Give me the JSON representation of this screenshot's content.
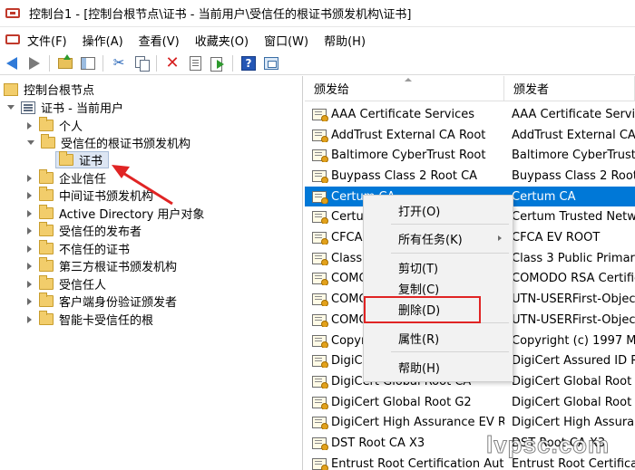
{
  "window": {
    "title": "控制台1 - [控制台根节点\\证书 - 当前用户\\受信任的根证书颁发机构\\证书]"
  },
  "menubar": {
    "items": [
      "文件(F)",
      "操作(A)",
      "查看(V)",
      "收藏夹(O)",
      "窗口(W)",
      "帮助(H)"
    ]
  },
  "toolbar": {
    "icons": [
      "back-icon",
      "forward-icon",
      "up-folder-icon",
      "show-hide-tree-icon",
      "cut-icon",
      "copy-icon",
      "delete-icon",
      "properties-icon",
      "export-icon",
      "help-icon",
      "action-pane-icon"
    ]
  },
  "tree": {
    "root": "控制台根节点",
    "store": "证书 - 当前用户",
    "nodes": [
      {
        "label": "个人",
        "expanded": false
      },
      {
        "label": "受信任的根证书颁发机构",
        "expanded": true
      },
      {
        "label": "证书",
        "selected": true
      },
      {
        "label": "企业信任",
        "expanded": false
      },
      {
        "label": "中间证书颁发机构",
        "expanded": false
      },
      {
        "label": "Active Directory 用户对象",
        "expanded": false
      },
      {
        "label": "受信任的发布者",
        "expanded": false
      },
      {
        "label": "不信任的证书",
        "expanded": false
      },
      {
        "label": "第三方根证书颁发机构",
        "expanded": false
      },
      {
        "label": "受信任人",
        "expanded": false
      },
      {
        "label": "客户端身份验证颁发者",
        "expanded": false
      },
      {
        "label": "智能卡受信任的根",
        "expanded": false
      }
    ]
  },
  "list": {
    "columns": [
      "颁发给",
      "颁发者"
    ],
    "rows": [
      {
        "issued_to": "AAA Certificate Services",
        "issued_by": "AAA Certificate Service"
      },
      {
        "issued_to": "AddTrust External CA Root",
        "issued_by": "AddTrust External CA Ro"
      },
      {
        "issued_to": "Baltimore CyberTrust Root",
        "issued_by": "Baltimore CyberTrust Ro"
      },
      {
        "issued_to": "Buypass Class 2 Root CA",
        "issued_by": "Buypass Class 2 Root CA"
      },
      {
        "issued_to": "Certum CA",
        "issued_by": "Certum CA",
        "selected": true
      },
      {
        "issued_to": "Certum",
        "issued_by": "Certum Trusted Netwo"
      },
      {
        "issued_to": "CFCA",
        "issued_by": "CFCA EV ROOT"
      },
      {
        "issued_to": "Class 3",
        "issued_by": "Class 3 Public Primary C"
      },
      {
        "issued_to": "COMOD",
        "issued_by": "COMODO RSA Certific"
      },
      {
        "issued_to": "COMOD",
        "issued_by": "UTN-USERFirst-Object"
      },
      {
        "issued_to": "COMOD",
        "issued_by": "UTN-USERFirst-Object"
      },
      {
        "issued_to": "Copyrig",
        "issued_by": "Copyright (c) 1997 Micr"
      },
      {
        "issued_to": "DigiCer",
        "issued_by": "DigiCert Assured ID Ro"
      },
      {
        "issued_to": "DigiCert Global Root CA",
        "issued_by": "DigiCert Global Root CA"
      },
      {
        "issued_to": "DigiCert Global Root G2",
        "issued_by": "DigiCert Global Root G"
      },
      {
        "issued_to": "DigiCert High Assurance EV Ro...",
        "issued_by": "DigiCert High Assurance"
      },
      {
        "issued_to": "DST Root CA X3",
        "issued_by": "DST Root CA X3"
      },
      {
        "issued_to": "Entrust Root Certification Auth...",
        "issued_by": "Entrust Root Certificati"
      }
    ]
  },
  "context_menu": {
    "items": [
      "打开(O)",
      "所有任务(K)",
      "剪切(T)",
      "复制(C)",
      "删除(D)",
      "属性(R)",
      "帮助(H)"
    ],
    "highlighted": "删除(D)"
  },
  "annotation": {
    "color": "#e02424"
  },
  "watermark": "lvpsc.com",
  "colors": {
    "selection": "#0078d7",
    "tree_selection": "#dde6f3",
    "annotation": "#e02424"
  }
}
